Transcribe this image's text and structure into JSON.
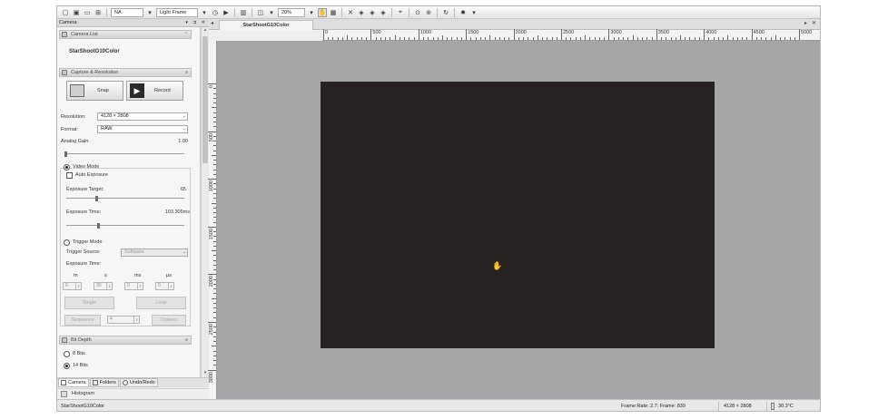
{
  "toolbar": {
    "camera_select": "NA",
    "frame_type_select": "Light Frame",
    "zoom_select": "20%",
    "icons": [
      "new-file-icon",
      "save-icon",
      "open-folder-icon",
      "grid-icon",
      "dropdown-icon",
      "timer-icon",
      "play-icon",
      "film-icon",
      "capture-icon",
      "dropdown-icon",
      "hand-icon",
      "display-icon",
      "cross-icon",
      "diamond-icon",
      "diamond-icon",
      "diamond-icon",
      "crosshair-icon",
      "circle-icon",
      "circle-icon",
      "rotate-icon",
      "gear-icon"
    ]
  },
  "left_panel": {
    "title": "Camera",
    "camera_list": {
      "header": "Camera List",
      "camera_name": "StarShootG10Color"
    },
    "capture": {
      "header": "Capture & Resolution",
      "snap_label": "Snap",
      "record_label": "Record",
      "resolution_label": "Resolution:",
      "resolution_value": "4128 × 2808",
      "format_label": "Format:",
      "format_value": "RAW",
      "analog_gain_label": "Analog Gain:",
      "analog_gain_value": "1.00",
      "analog_gain_level": 0.0,
      "video_mode_label": "Video Mode",
      "video_mode_selected": true,
      "auto_exposure_label": "Auto Exposure",
      "auto_exposure_checked": false,
      "exposure_target_label": "Exposure Target:",
      "exposure_target_value": "65",
      "exposure_target_level": 0.25,
      "exposure_time_label": "Exposure Time:",
      "exposure_time_value": "103.305ms",
      "exposure_time_level": 0.27,
      "trigger_mode_label": "Trigger Mode",
      "trigger_mode_selected": false,
      "trigger_source_label": "Trigger Source:",
      "trigger_source_value": "Software",
      "trigger_exposure_label": "Exposure Time:",
      "time_units": [
        "m",
        "s",
        "ms",
        "µs"
      ],
      "time_values": [
        "0",
        "30",
        "0",
        "0"
      ],
      "single_label": "Single",
      "loop_label": "Loop",
      "sequence_label": "Sequence",
      "sequence_value": "4",
      "options_label": "Options"
    },
    "bit_depth": {
      "header": "Bit Depth",
      "options": [
        "8 Bits",
        "14 Bits"
      ],
      "selected": "14 Bits"
    },
    "bottom_tabs": [
      "Camera",
      "Folders",
      "Undo/Redo"
    ],
    "histogram_label": "Histogram"
  },
  "document": {
    "tab_title": "StarShootG10Color",
    "ruler_top": [
      "0",
      "500",
      "1000",
      "1500",
      "2000",
      "2500",
      "3000",
      "3500",
      "4000",
      "4500",
      "5000"
    ],
    "ruler_left": [
      "0",
      "500",
      "1000",
      "1500",
      "2000",
      "2500",
      "3000"
    ]
  },
  "status_bar": {
    "camera_name": "StarShootG10Color",
    "frame_info": "Frame Rate: 2.7; Frame: 839",
    "resolution": "4128 × 2808",
    "temperature": "30.3°C"
  }
}
